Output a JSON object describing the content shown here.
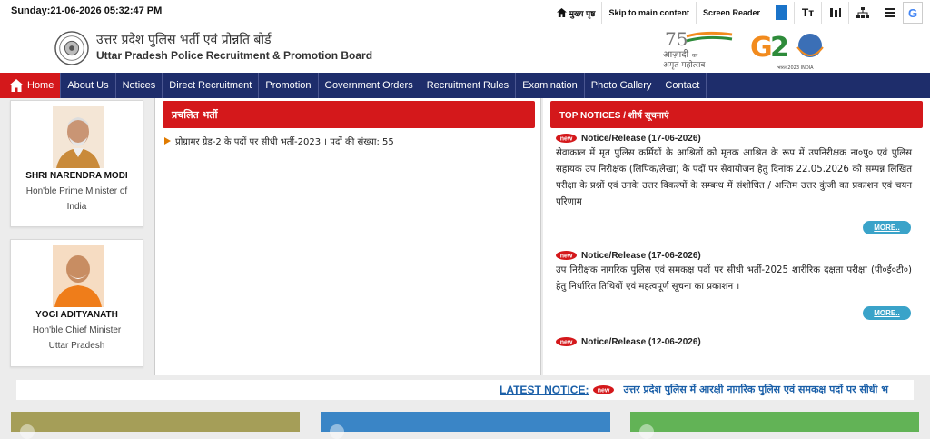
{
  "topbar": {
    "datetime": "Sunday:21-06-2026 05:32:47 PM",
    "home_label": "मुख्य पृष्ठ",
    "skip_label": "Skip to main content",
    "screen_reader_label": "Screen Reader",
    "font_size_glyph": "Tт"
  },
  "header": {
    "title_hi": "उत्तर प्रदेश पुलिस भर्ती एवं प्रोन्नति बोर्ड",
    "title_en": "Uttar Pradesh Police Recruitment & Promotion Board"
  },
  "nav": {
    "items": [
      "Home",
      "About Us",
      "Notices",
      "Direct Recruitment",
      "Promotion",
      "Government Orders",
      "Recruitment Rules",
      "Examination",
      "Photo Gallery",
      "Contact"
    ]
  },
  "leaders": [
    {
      "name": "SHRI NARENDRA MODI",
      "role_line1": "Hon'ble Prime Minister of",
      "role_line2": "India"
    },
    {
      "name": "YOGI ADITYANATH",
      "role_line1": "Hon'ble Chief Minister",
      "role_line2": "Uttar Pradesh"
    }
  ],
  "current_recruitment": {
    "heading": "प्रचलित भर्ती",
    "items": [
      "प्रोग्रामर ग्रेड-2 के पदों पर सीधी भर्ती-2023 । पदों की संख्या: 55"
    ]
  },
  "top_notices": {
    "heading": "TOP NOTICES / शीर्ष सूचनाएं",
    "more_label": "MORE..",
    "notices": [
      {
        "title": "Notice/Release (17-06-2026)",
        "body": "सेवाकाल में मृत पुलिस कर्मियों के आश्रितों को मृतक आश्रित के रूप में उपनिरीक्षक ना०पु० एवं पुलिस सहायक उप निरीक्षक (लिपिक/लेखा) के पदों पर सेवायोजन हेतु दिनांक 22.05.2026 को सम्पन्न लिखित परीक्षा के प्रश्नों एवं उनके उत्तर विकल्पों के सम्बन्ध में संशोधित / अन्तिम उत्तर कुंजी का प्रकाशन एवं चयन परिणाम"
      },
      {
        "title": "Notice/Release (17-06-2026)",
        "body": "उप निरीक्षक नागरिक पुलिस एवं समकक्ष पदों पर सीधी भर्ती-2025 शारीरिक दक्षता परीक्षा (पी०ई०टी०) हेतु निर्धारित तिथियों एवं महत्वपूर्ण सूचना का प्रकाशन ।"
      },
      {
        "title": "Notice/Release (12-06-2026)",
        "body": ""
      }
    ]
  },
  "ticker": {
    "label": "LATEST NOTICE:",
    "text": "उत्तर प्रदेश पुलिस में आरक्षी नागरिक पुलिस एवं समकक्ष पदों पर सीधी भ"
  },
  "colors": {
    "nav_bg": "#1e2d6b",
    "accent_red": "#d4181b",
    "more_btn": "#3aa3c9",
    "ticker_text": "#1a5fa8",
    "box1": "#a59e58",
    "box2": "#3a85c6",
    "box3": "#62b356"
  }
}
